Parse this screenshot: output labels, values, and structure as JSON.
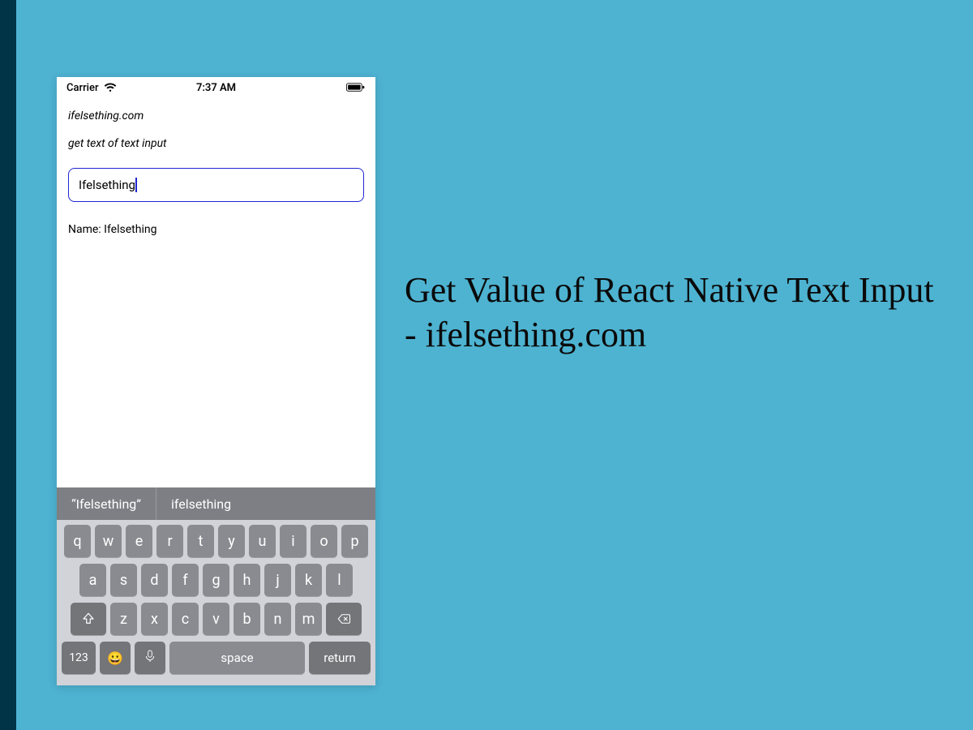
{
  "colors": {
    "bg": "#4eb2d1",
    "band": "#023447",
    "inputBorder": "#2026d3",
    "kbBg": "#d1d3d9",
    "keyBg": "#898b90",
    "specialKeyBg": "#747579",
    "suggestionBar": "#7d7f84"
  },
  "statusBar": {
    "carrier": "Carrier",
    "time": "7:37 AM"
  },
  "app": {
    "brand": "ifelsething.com",
    "subtitle": "get text of text input",
    "inputValue": "Ifelsething",
    "outputLabel": "Name: ",
    "outputValue": "Ifelsething"
  },
  "keyboard": {
    "suggestions": [
      "“Ifelsething”",
      "ifelsething"
    ],
    "rows": [
      [
        "q",
        "w",
        "e",
        "r",
        "t",
        "y",
        "u",
        "i",
        "o",
        "p"
      ],
      [
        "a",
        "s",
        "d",
        "f",
        "g",
        "h",
        "j",
        "k",
        "l"
      ],
      [
        "z",
        "x",
        "c",
        "v",
        "b",
        "n",
        "m"
      ]
    ],
    "numKey": "123",
    "spaceLabel": "space",
    "returnLabel": "return",
    "icons": {
      "shift": "shift-icon",
      "backspace": "backspace-icon",
      "emoji": "emoji-icon",
      "mic": "mic-icon"
    }
  },
  "headline": "Get Value of React Native Text Input - ifelsething.com"
}
